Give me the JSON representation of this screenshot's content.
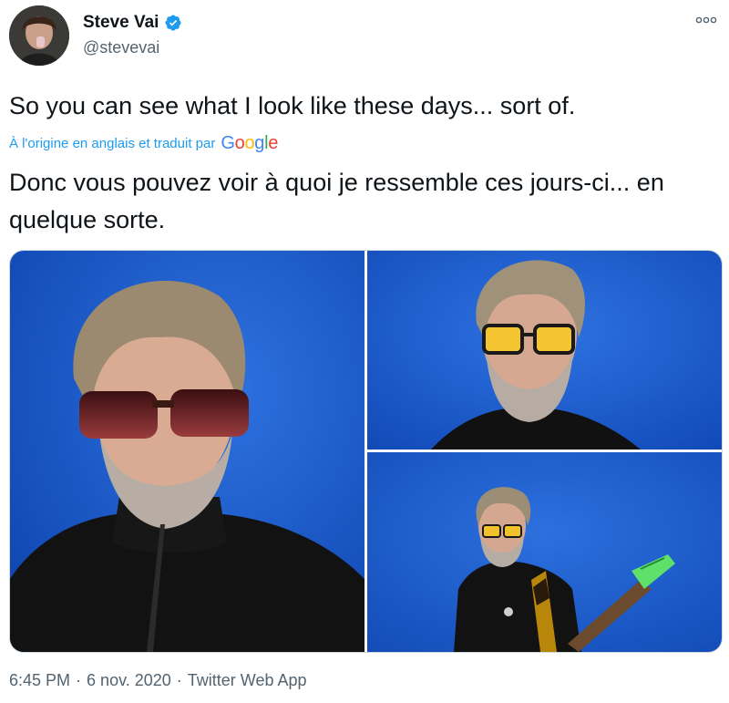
{
  "author": {
    "display_name": "Steve Vai",
    "handle": "@stevevai",
    "verified_icon": "verified-badge-icon",
    "avatar_icon": "avatar-photo"
  },
  "tweet": {
    "text": "So you can see what I look like these days... sort of.",
    "translation_note": "À l'origine en anglais et traduit par",
    "translation_provider": "Google",
    "translated_text": "Donc vous pouvez voir à quoi je ressemble ces jours-ci... en quelque sorte."
  },
  "media": {
    "count": 3,
    "background_color": "#1556c9"
  },
  "meta": {
    "time": "6:45 PM",
    "date": "6 nov. 2020",
    "source": "Twitter Web App",
    "separator": "·"
  },
  "colors": {
    "verified": "#1d9bf0",
    "link": "#1d9bf0",
    "secondary_text": "#536471"
  }
}
